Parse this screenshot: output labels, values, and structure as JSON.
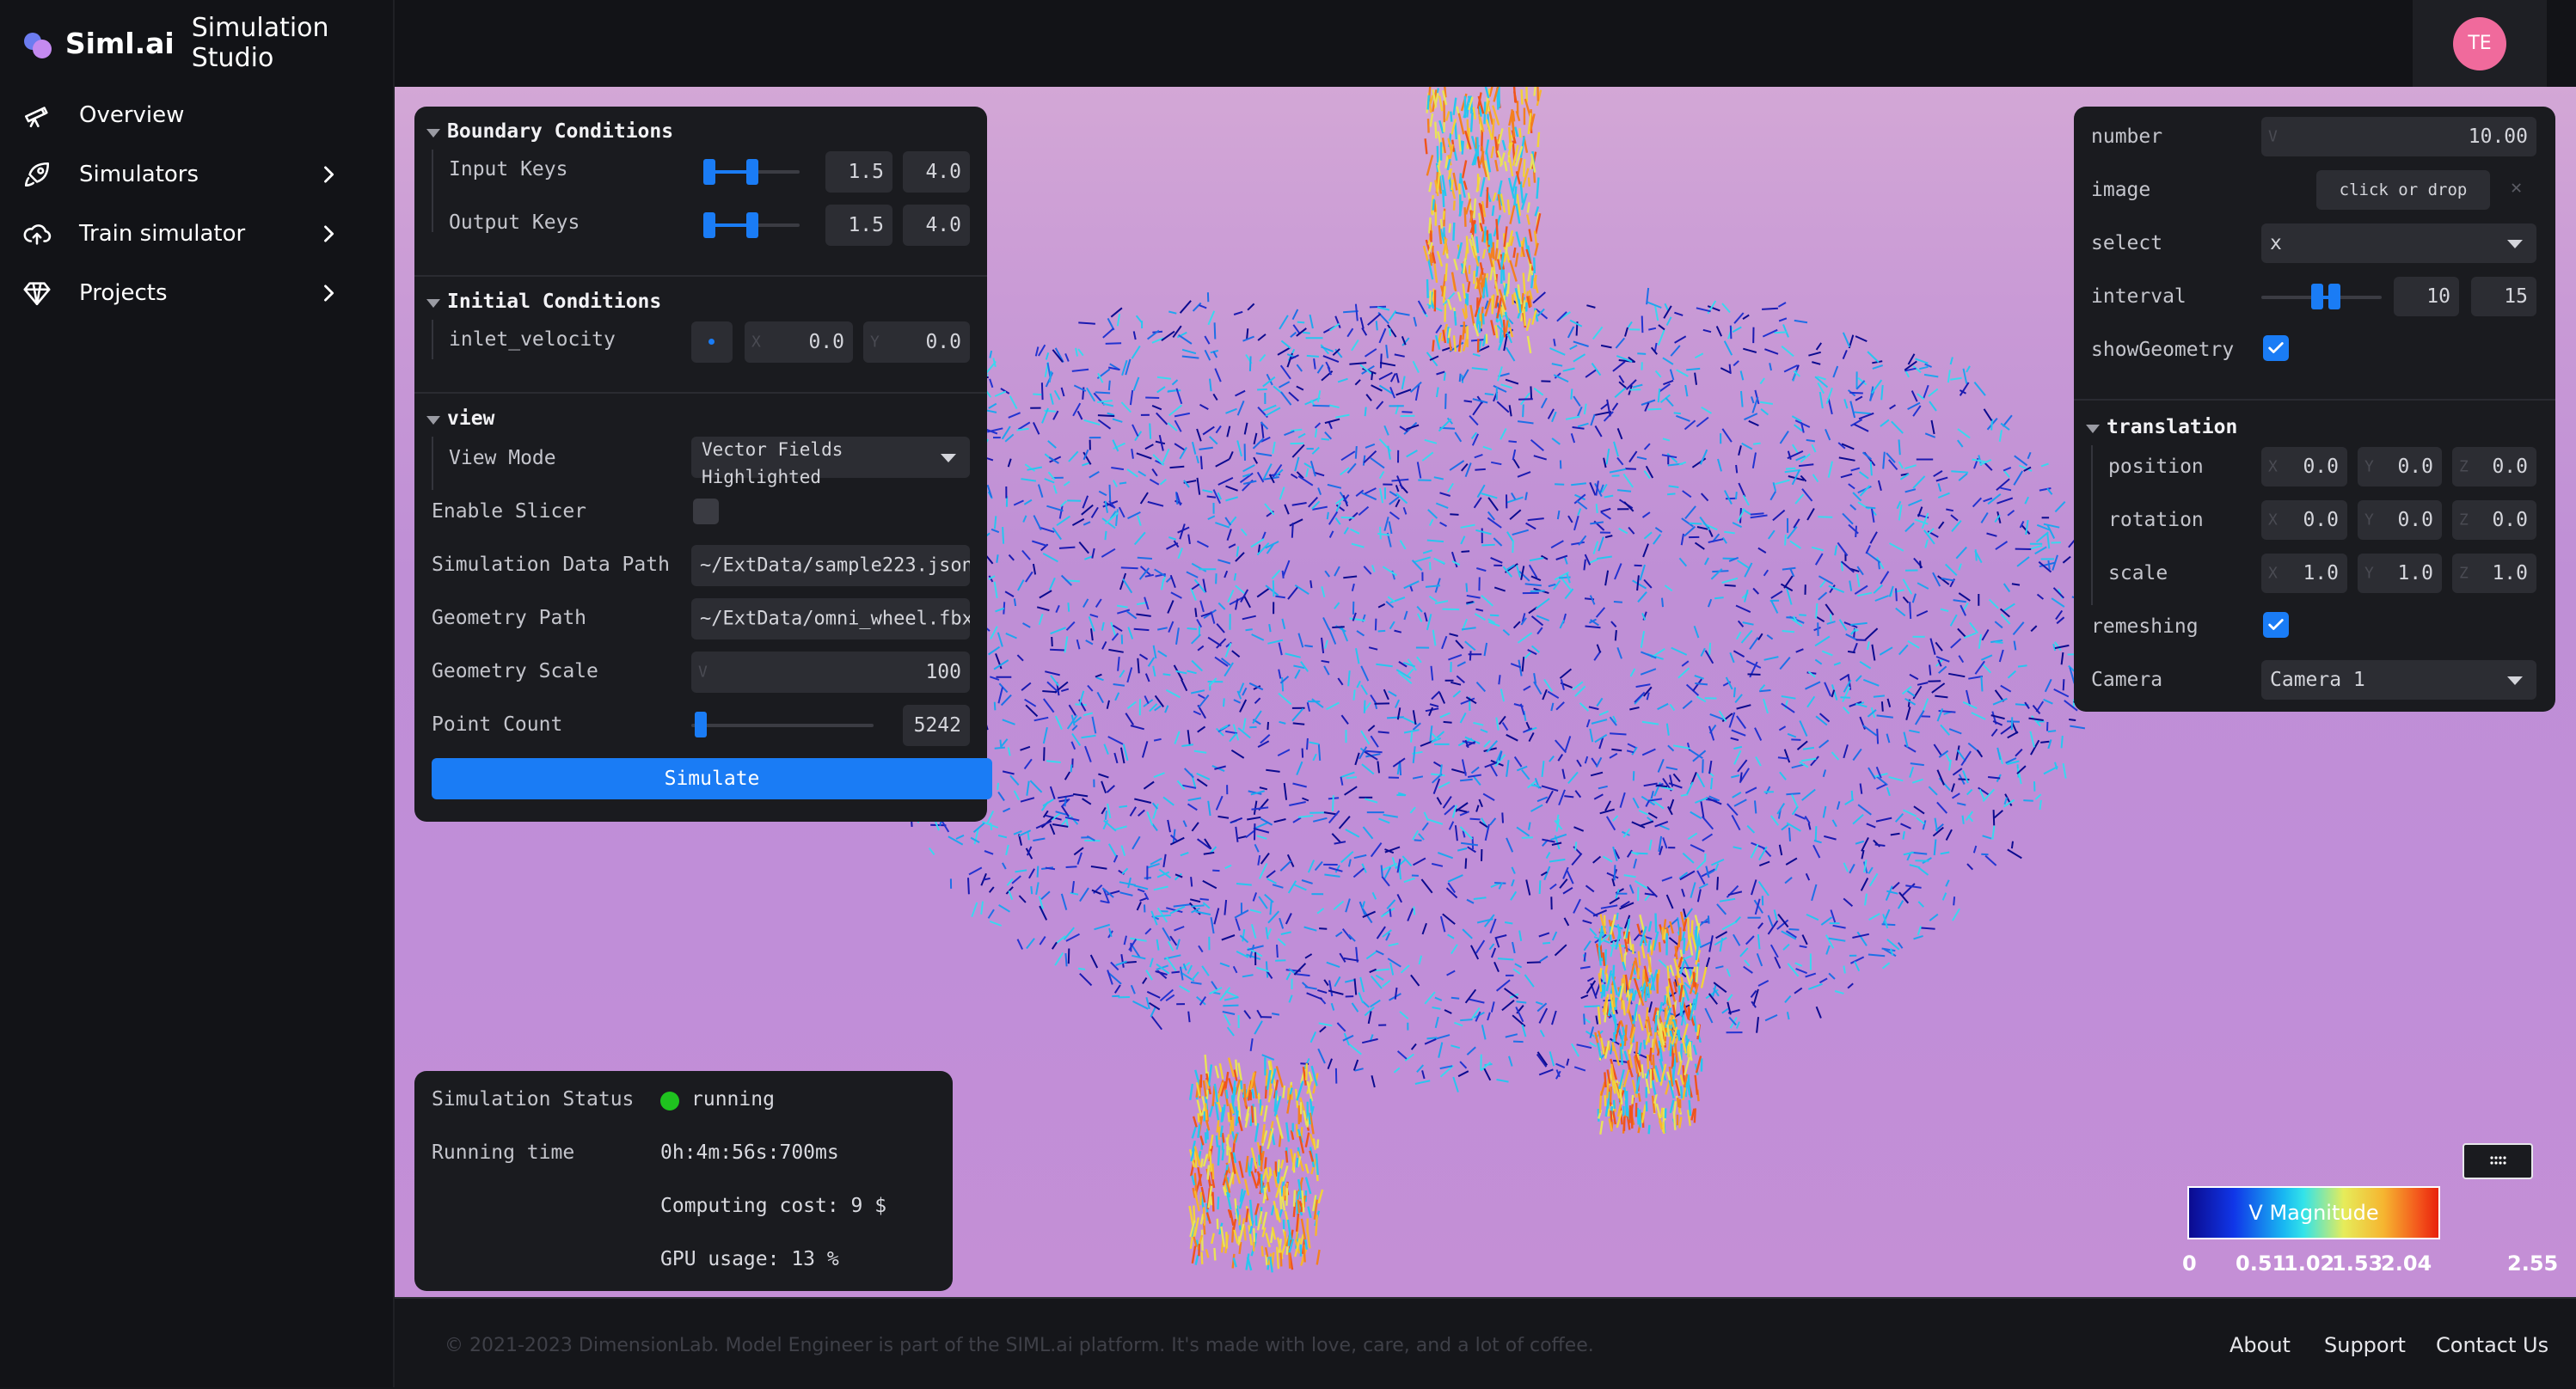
{
  "brand": {
    "name": "Siml.ai",
    "studio": "Simulation Studio"
  },
  "nav": [
    {
      "label": "Overview",
      "icon": "telescope-icon",
      "has_children": false
    },
    {
      "label": "Simulators",
      "icon": "rocket-icon",
      "has_children": true
    },
    {
      "label": "Train simulator",
      "icon": "cloud-upload-icon",
      "has_children": true
    },
    {
      "label": "Projects",
      "icon": "diamond-icon",
      "has_children": true
    }
  ],
  "user": {
    "initials": "TE",
    "avatar_color": "#f06a9c"
  },
  "left_panel": {
    "boundary": {
      "title": "Boundary Conditions",
      "input_keys": {
        "label": "Input Keys",
        "min": "1.5",
        "max": "4.0"
      },
      "output_keys": {
        "label": "Output Keys",
        "min": "1.5",
        "max": "4.0"
      }
    },
    "initial": {
      "title": "Initial Conditions",
      "inlet_velocity": {
        "label": "inlet_velocity",
        "x_axis": "X",
        "x": "0.0",
        "y_axis": "Y",
        "y": "0.0"
      }
    },
    "view": {
      "title": "view",
      "view_mode": {
        "label": "View Mode",
        "value_line1": "Vector Fields",
        "value_line2": "Highlighted"
      },
      "enable_slicer": {
        "label": "Enable Slicer",
        "checked": false
      },
      "sim_data_path": {
        "label": "Simulation Data Path",
        "value": "~/ExtData/sample223.json"
      },
      "geometry_path": {
        "label": "Geometry Path",
        "value": "~/ExtData/omni_wheel.fbx"
      },
      "geometry_scale": {
        "label": "Geometry Scale",
        "axis": "V",
        "value": "100"
      },
      "point_count": {
        "label": "Point Count",
        "value": "5242",
        "fraction": 0.02
      }
    },
    "simulate_label": "Simulate"
  },
  "status_panel": {
    "status_label": "Simulation Status",
    "status_value": "running",
    "status_color": "#1fc21f",
    "running_label": "Running time",
    "running_value": "0h:4m:56s:700ms",
    "cost": "Computing cost: 9 $",
    "gpu": "GPU usage: 13 %"
  },
  "right_panel": {
    "number": {
      "label": "number",
      "axis": "V",
      "value": "10.00"
    },
    "image": {
      "label": "image",
      "button": "click or drop",
      "clear": "✕"
    },
    "select": {
      "label": "select",
      "value": "x"
    },
    "interval": {
      "label": "interval",
      "min": "10",
      "max": "15"
    },
    "show_geometry": {
      "label": "showGeometry",
      "checked": true
    },
    "translation": {
      "title": "translation",
      "position": {
        "label": "position",
        "x": "0.0",
        "y": "0.0",
        "z": "0.0"
      },
      "rotation": {
        "label": "rotation",
        "x": "0.0",
        "y": "0.0",
        "z": "0.0"
      },
      "scale": {
        "label": "scale",
        "x": "1.0",
        "y": "1.0",
        "z": "1.0"
      },
      "axes": {
        "x": "X",
        "y": "Y",
        "z": "Z"
      }
    },
    "remeshing": {
      "label": "remeshing",
      "checked": true
    },
    "camera": {
      "label": "Camera",
      "value": "Camera 1"
    }
  },
  "legend": {
    "title": "V Magnitude",
    "ticks": [
      "0",
      "0.51",
      "1.02",
      "1.53",
      "2.04",
      "2.55"
    ],
    "colors": [
      "#0b0b8f",
      "#1036e8",
      "#19b8f2",
      "#33e3e9",
      "#e6ec5a",
      "#f6b530",
      "#f3561c",
      "#e8220c"
    ]
  },
  "footer": {
    "copyright": "© 2021-2023 DimensionLab. Model Engineer is part of the SIML.ai platform. It's made with love, care, and a lot of coffee.",
    "links": [
      "About",
      "Support",
      "Contact Us"
    ]
  }
}
